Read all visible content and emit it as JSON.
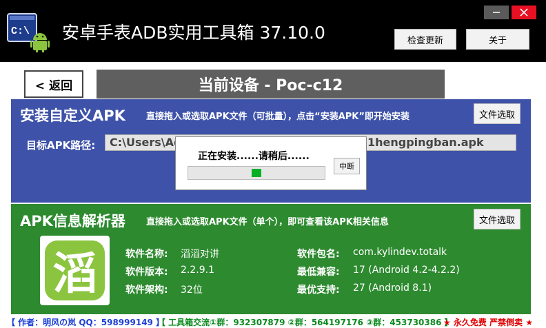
{
  "window": {
    "title": "安卓手表ADB实用工具箱  37.10.0",
    "icon": "terminal-android-icon",
    "update_label": "检查更新",
    "about_label": "关于"
  },
  "nav": {
    "back_label": "< 返回",
    "device_title": "当前设备 - Poc-c12"
  },
  "install": {
    "title": "安装自定义APK",
    "hint": "直接拖入或选取APK文件（可批量），点击“安装APK”即开始安装",
    "file_button": "文件选取",
    "path_label": "目标APK路径:",
    "path_value_left": "C:\\Users\\Ad",
    "path_value_right": "1hengpingban.apk"
  },
  "progress": {
    "message": "正在安装......请稍后......",
    "cancel_label": "中断",
    "level_percent": 50
  },
  "parser": {
    "title": "APK信息解析器",
    "hint": "直接拖入或选取APK文件（单个），即可查看该APK相关信息",
    "file_button": "文件选取",
    "app_icon": "app-glyph-icon",
    "app_glyph": "滔",
    "fields": [
      {
        "label": "软件名称:",
        "value": "滔滔对讲"
      },
      {
        "label": "软件版本:",
        "value": "2.2.9.1"
      },
      {
        "label": "软件架构:",
        "value": "32位"
      },
      {
        "label": "软件包名:",
        "value": "com.kylindev.totalk"
      },
      {
        "label": "最低兼容:",
        "value": "17  (Android 4.2-4.2.2)"
      },
      {
        "label": "最优支持:",
        "value": "27  (Android 8.1)"
      }
    ]
  },
  "footer": {
    "author": "【 作者：明风の岚  QQ：598999149 】",
    "groups": "【 工具箱交流①群：932307879  ②群：564197176  ③群：453730386 】",
    "notice": "★ 永久免费 严禁倒卖 ★"
  },
  "colors": {
    "install_panel": "#3d52a8",
    "parser_panel": "#2d8a2f",
    "progress_fill": "#06b025",
    "footer_author": "#1b3fd6",
    "footer_groups": "#0a8a1e",
    "footer_notice": "#e00000"
  }
}
